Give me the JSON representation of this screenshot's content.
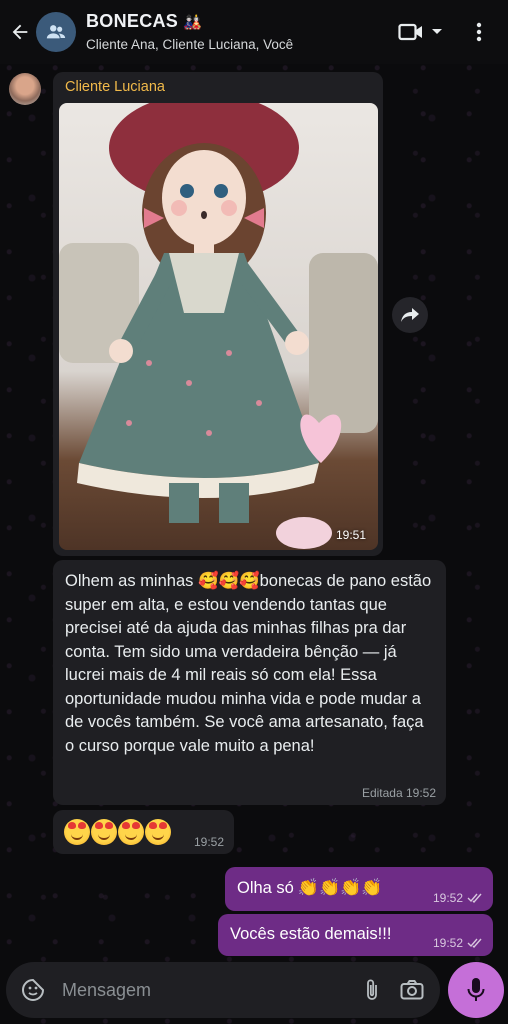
{
  "header": {
    "title": "BONECAS",
    "title_emoji": "🎎",
    "subtitle": "Cliente Ana, Cliente Luciana, Você",
    "icons": [
      "back-arrow-icon",
      "group-icon",
      "video-call-icon",
      "chevron-down-icon",
      "more-vert-icon"
    ]
  },
  "messages": [
    {
      "type": "photo",
      "sender": "Cliente Luciana",
      "time": "19:51",
      "image_description_icon": "doll-photo"
    },
    {
      "type": "text",
      "text": "Olhem as minhas 🥰🥰🥰bonecas de pano estão super em alta, e estou vendendo tantas que precisei até da ajuda das minhas filhas pra dar conta. Tem sido uma verdadeira bênção — já lucrei mais de 4 mil reais só com ela! Essa oportunidade mudou minha vida e pode mudar a de vocês também. Se você ama artesanato, faça o curso porque vale muito a pena!",
      "meta": "Editada 19:52"
    },
    {
      "type": "emoji",
      "emojis": "🥰🥰🥰🥰",
      "time": "19:52"
    },
    {
      "type": "outgoing",
      "text": "Olha só",
      "emojis": "👏👏👏👏",
      "time": "19:52"
    },
    {
      "type": "outgoing",
      "text": "Vocês estão demais!!!",
      "time": "19:52"
    }
  ],
  "composer": {
    "placeholder": "Mensagem",
    "icons": [
      "sticker-icon",
      "attach-icon",
      "camera-icon",
      "mic-icon"
    ]
  },
  "colors": {
    "accent_outgoing": "#6e2c86",
    "mic_button": "#c56fd8",
    "sender_name": "#f0b94a",
    "incoming_bubble": "#1f1f23"
  }
}
